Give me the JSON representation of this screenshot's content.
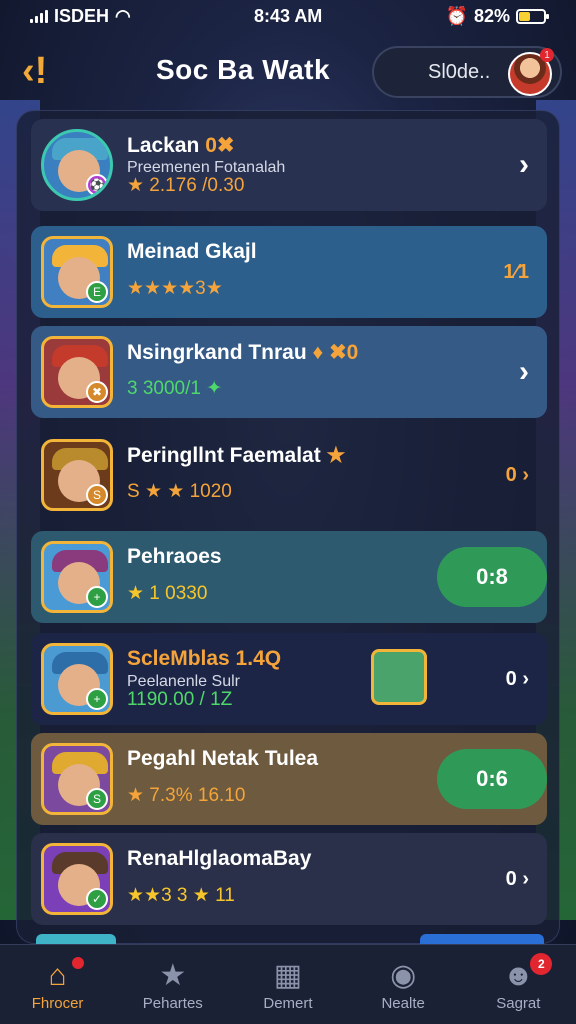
{
  "status": {
    "carrier": "ISDEH",
    "time": "8:43 AM",
    "battery": "82%",
    "battery_level": 0.45
  },
  "header": {
    "back_label": "‹!",
    "title": "Soc Ba Watk",
    "profile_text": "Sl0de..",
    "notification_count": "1"
  },
  "players": [
    {
      "name": "Lackan",
      "name_badge": "0✖",
      "sub": "Preemenen Fotanalah",
      "stat": "★ 2.176 /0.30",
      "right": "›",
      "bg": "#283150",
      "hat": "#4aa3c9",
      "thumbBg": "#3a80c0",
      "badge": "⚽"
    },
    {
      "name": "Meinad Gkajl",
      "name_badge": "",
      "sub": "",
      "stat": "★★★★3★",
      "right": "1⁄1",
      "bg": "#2d5f8c",
      "hat": "#f2b53a",
      "thumbBg": "#3f7fc2",
      "badge": "E"
    },
    {
      "name": "Nsingrkand Tnrau",
      "name_badge": "♦ ✖0",
      "sub": "",
      "stat": "3 3000/1 ✦",
      "right": "›",
      "bg": "#355a86",
      "hat": "#c43b2c",
      "thumbBg": "#9a3a3a",
      "badge": "✖"
    },
    {
      "name": "Peringllnt Faemalat",
      "name_badge": "★",
      "sub": "",
      "stat": "S ★ ★ 1020",
      "right": "0 ›",
      "bg": "transparent",
      "hat": "#b98b2c",
      "thumbBg": "#6c3b1c",
      "badge": "S"
    },
    {
      "name": "Pehraoes",
      "name_badge": "",
      "sub": "",
      "stat": "★ 1 0330",
      "right": "0:8",
      "bg": "#2e5a70",
      "hat": "#8a3b7d",
      "thumbBg": "#4a9ad6",
      "badge": "+"
    },
    {
      "name": "ScleMblas",
      "name_badge": "1.4Q",
      "sub": "Peelanenle Sulr",
      "stat": "1190.00 / 1Z",
      "right": "0 ›",
      "bg": "#1d2546",
      "hat": "#2d6ea8",
      "thumbBg": "#4b9bd2",
      "badge": "+"
    },
    {
      "name": "Pegahl Netak Tulea",
      "name_badge": "",
      "sub": "",
      "stat": "★ 7.3% 16.10",
      "right": "0:6",
      "bg": "#6e5a3e",
      "hat": "#e0a930",
      "thumbBg": "#7b4a9e",
      "badge": "S"
    },
    {
      "name": "RenaHlglaomaBay",
      "name_badge": "",
      "sub": "",
      "stat": "★★3 3 ★ 11",
      "right": "0 ›",
      "bg": "#2a2f4a",
      "hat": "#5a3a2a",
      "thumbBg": "#7b3fb8",
      "badge": "✓"
    }
  ],
  "nav": [
    {
      "label": "Fhrocer",
      "icon": "⌂",
      "icon_name": "home-icon",
      "active": true,
      "dot": true,
      "count": ""
    },
    {
      "label": "Pehartes",
      "icon": "★",
      "icon_name": "star-icon",
      "active": false,
      "dot": false,
      "count": ""
    },
    {
      "label": "Demert",
      "icon": "▦",
      "icon_name": "calculator-icon",
      "active": false,
      "dot": false,
      "count": ""
    },
    {
      "label": "Nealte",
      "icon": "◉",
      "icon_name": "ball-icon",
      "active": false,
      "dot": false,
      "count": ""
    },
    {
      "label": "Sagrat",
      "icon": "☻",
      "icon_name": "profile-icon",
      "active": false,
      "dot": false,
      "count": "2"
    }
  ]
}
